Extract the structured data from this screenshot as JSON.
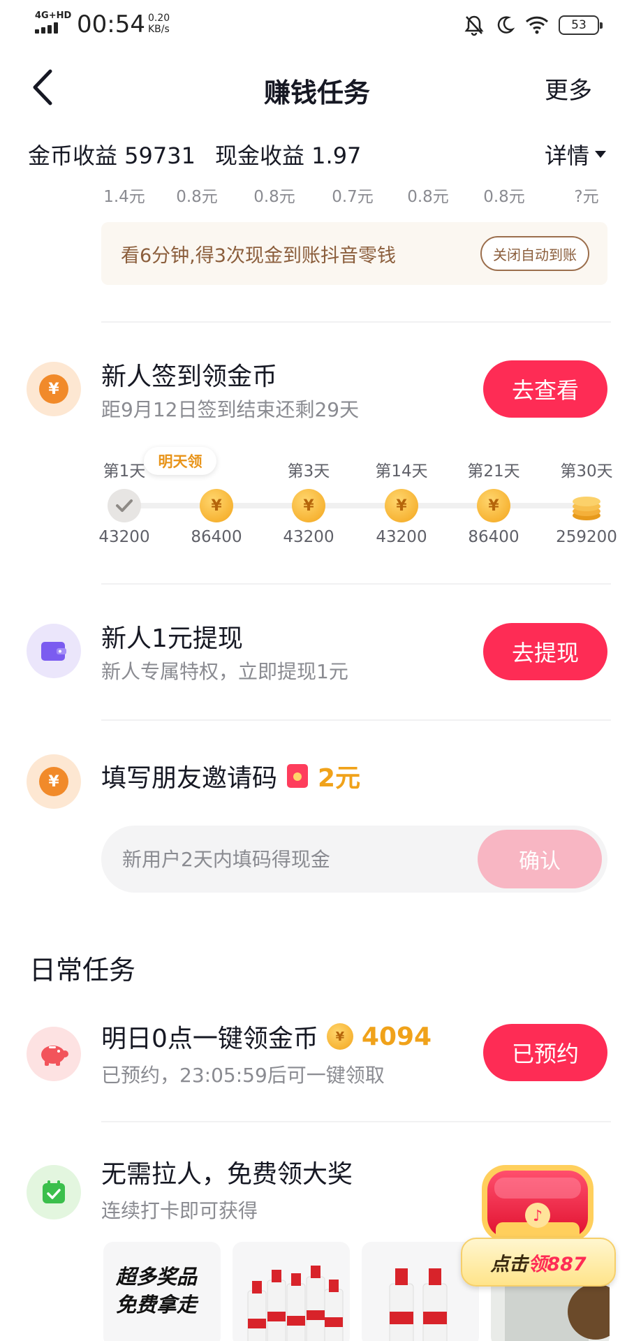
{
  "status_bar": {
    "network": "4G+HD",
    "time": "00:54",
    "speed_value": "0.20",
    "speed_unit": "KB/s",
    "battery": "53",
    "icons": [
      "bell-off-icon",
      "moon-icon",
      "wifi-icon",
      "battery-icon"
    ]
  },
  "nav": {
    "title": "赚钱任务",
    "more": "更多"
  },
  "earnings": {
    "coins_label": "金币收益 59731",
    "cash_label": "现金收益 1.97",
    "detail": "详情"
  },
  "cash_amounts": [
    "1.4元",
    "0.8元",
    "0.8元",
    "0.7元",
    "0.8元",
    "0.8元",
    "?元"
  ],
  "auto_cash": {
    "text": "看6分钟,得3次现金到账抖音零钱",
    "button": "关闭自动到账"
  },
  "signin": {
    "title": "新人签到领金币",
    "subtitle": "距9月12日签到结束还剩29天",
    "button": "去查看",
    "tomorrow_tag": "明天领",
    "days": [
      {
        "label": "第1天",
        "value": "43200",
        "state": "done"
      },
      {
        "label": "",
        "value": "86400",
        "state": "tomorrow"
      },
      {
        "label": "第3天",
        "value": "43200",
        "state": "coin"
      },
      {
        "label": "第14天",
        "value": "43200",
        "state": "coin"
      },
      {
        "label": "第21天",
        "value": "86400",
        "state": "coin"
      },
      {
        "label": "第30天",
        "value": "259200",
        "state": "stack"
      }
    ]
  },
  "withdraw": {
    "title": "新人1元提现",
    "subtitle": "新人专属特权，立即提现1元",
    "button": "去提现"
  },
  "invite": {
    "title": "填写朋友邀请码",
    "reward": "2元",
    "placeholder": "新用户2天内填码得现金",
    "button": "确认"
  },
  "daily": {
    "section_title": "日常任务",
    "task1": {
      "title": "明日0点一键领金币",
      "coins": "4094",
      "subtitle": "已预约，23:05:59后可一键领取",
      "button": "已预约"
    },
    "task2": {
      "title": "无需拉人，免费领大奖",
      "subtitle": "连续打卡即可获得",
      "prize_text_1": "超多奖品",
      "prize_text_2": "免费拿走"
    }
  },
  "treasure": {
    "label_prefix": "点击",
    "label_highlight": "领887"
  },
  "colors": {
    "primary_red": "#fe2c55",
    "gold": "#f0a21a",
    "muted_text": "#8a8b91"
  }
}
